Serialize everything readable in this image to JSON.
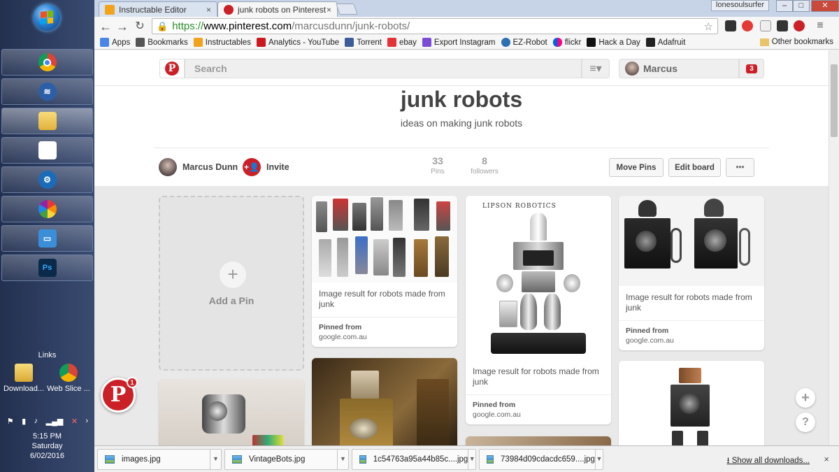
{
  "taskbar": {
    "links_label": "Links",
    "desktop_items": [
      {
        "label": "Download..."
      },
      {
        "label": "Web Slice ..."
      }
    ],
    "clock": {
      "time": "5:15 PM",
      "day": "Saturday",
      "date": "6/02/2016"
    }
  },
  "browser": {
    "tabs": [
      {
        "title": "Instructable Editor",
        "close": "×"
      },
      {
        "title": "junk robots on Pinterest",
        "close": "×"
      }
    ],
    "profile_name": "lonesoulsurfer",
    "url_scheme": "https://",
    "url_host": "www.pinterest.com",
    "url_path": "/marcusdunn/junk-robots/",
    "bookmarks": [
      {
        "label": "Apps",
        "color": "#4a86e8"
      },
      {
        "label": "Bookmarks",
        "color": "#555555"
      },
      {
        "label": "Instructables",
        "color": "#f2a31b"
      },
      {
        "label": "Analytics - YouTube",
        "color": "#cc181e"
      },
      {
        "label": "Torrent",
        "color": "#3d5c99"
      },
      {
        "label": "ebay",
        "color": "#e53238"
      },
      {
        "label": "Export Instagram",
        "color": "#7b4dd6"
      },
      {
        "label": "EZ-Robot",
        "color": "#2c6fb3"
      },
      {
        "label": "flickr",
        "color": "#ff0084"
      },
      {
        "label": "Hack a Day",
        "color": "#111111"
      },
      {
        "label": "Adafruit",
        "color": "#222222"
      }
    ],
    "other_bookmarks": "Other bookmarks"
  },
  "pinterest": {
    "search_placeholder": "Search",
    "user_name": "Marcus",
    "notifications": "3",
    "board_title": "junk robots",
    "board_description": "ideas on making junk robots",
    "owner_name": "Marcus Dunn",
    "invite_label": "Invite",
    "stats": [
      {
        "value": "33",
        "label": "Pins"
      },
      {
        "value": "8",
        "label": "followers"
      }
    ],
    "buttons": {
      "move_pins": "Move Pins",
      "edit_board": "Edit board",
      "more": "•••"
    },
    "add_pin": {
      "plus": "+",
      "label": "Add a Pin"
    },
    "pins": [
      {
        "description": "Image result for robots made from junk",
        "pinned_from_label": "Pinned from",
        "source": "google.com.au"
      },
      {
        "description": "Image result for robots made from junk",
        "pinned_from_label": "Pinned from",
        "source": "google.com.au",
        "image_caption": "LIPSON ROBOTICS"
      },
      {
        "description": "Image result for robots made from junk",
        "pinned_from_label": "Pinned from",
        "source": "google.com.au"
      }
    ],
    "float_badge": "1",
    "side_buttons": {
      "add": "+",
      "help": "?"
    }
  },
  "downloads": {
    "items": [
      {
        "name": "images.jpg"
      },
      {
        "name": "VintageBots.jpg"
      },
      {
        "name": "1c54763a95a44b85c....jpg"
      },
      {
        "name": "73984d09cdacdc659....jpg"
      }
    ],
    "show_all": "Show all downloads...",
    "close": "×"
  },
  "colors": {
    "pinterest_red": "#cb2027",
    "chrome_green": "#2a8d2a"
  }
}
